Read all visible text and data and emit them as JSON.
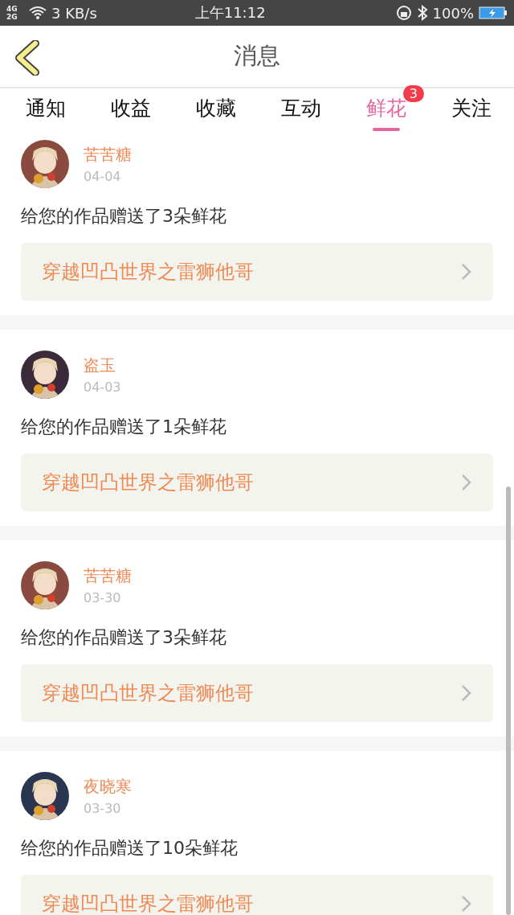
{
  "status_bar": {
    "network": "4G 2G",
    "speed": "3 KB/s",
    "time": "上午11:12",
    "battery": "100%"
  },
  "header": {
    "title": "消息"
  },
  "tabs": [
    {
      "label": "通知",
      "selected": false
    },
    {
      "label": "收益",
      "selected": false
    },
    {
      "label": "收藏",
      "selected": false
    },
    {
      "label": "互动",
      "selected": false
    },
    {
      "label": "鲜花",
      "selected": true,
      "badge": "3"
    },
    {
      "label": "关注",
      "selected": false
    }
  ],
  "messages": [
    {
      "name": "苦苦糖",
      "date": "04-04",
      "text": "给您的作品赠送了3朵鲜花",
      "work": "穿越凹凸世界之雷狮他哥"
    },
    {
      "name": "盗玉",
      "date": "04-03",
      "text": "给您的作品赠送了1朵鲜花",
      "work": "穿越凹凸世界之雷狮他哥"
    },
    {
      "name": "苦苦糖",
      "date": "03-30",
      "text": "给您的作品赠送了3朵鲜花",
      "work": "穿越凹凸世界之雷狮他哥"
    },
    {
      "name": "夜晓寒",
      "date": "03-30",
      "text": "给您的作品赠送了10朵鲜花",
      "work": "穿越凹凸世界之雷狮他哥"
    }
  ]
}
